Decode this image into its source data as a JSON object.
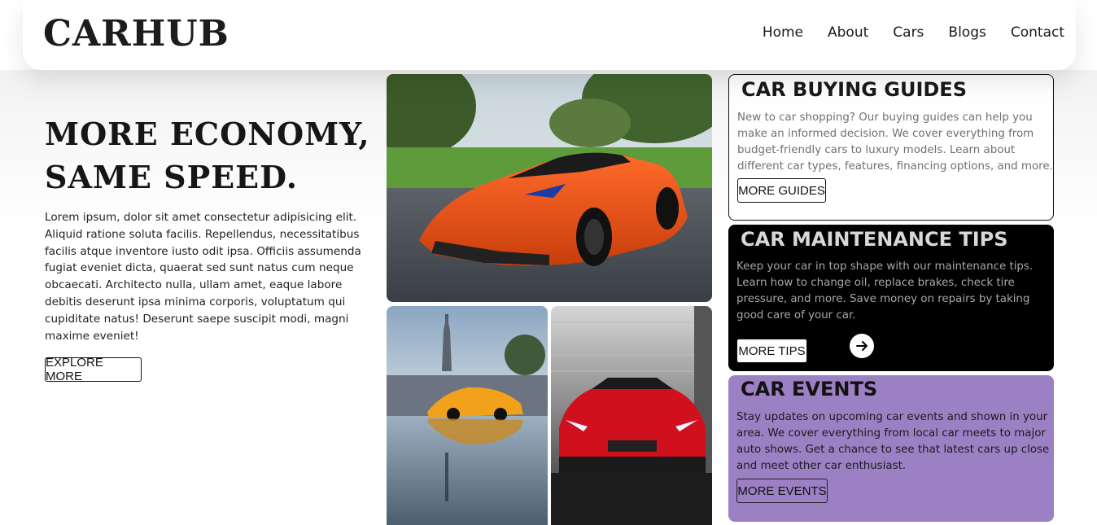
{
  "header": {
    "logo": "CARHUB",
    "nav": [
      "Home",
      "About",
      "Cars",
      "Blogs",
      "Contact"
    ]
  },
  "hero": {
    "title": "MORE ECONOMY, SAME SPEED.",
    "body": "Lorem ipsum, dolor sit amet consectetur adipisicing elit. Aliquid ratione soluta facilis. Repellendus, necessitatibus facilis atque inventore iusto odit ipsa. Officiis assumenda fugiat eveniet dicta, quaerat sed sunt natus cum neque obcaecati. Architecto nulla, ullam amet, eaque labore debitis deserunt ipsa minima corporis, voluptatum qui cupiditate natus! Deserunt saepe suscipit modi, magni maxime eveniet!",
    "button": "EXPLORE MORE"
  },
  "cards": [
    {
      "title": "CAR BUYING GUIDES",
      "body": "New to car shopping? Our buying guides can help you make an informed decision. We cover everything from budget-friendly cars to luxury models. Learn about different car types, features, financing options, and more.",
      "button": "MORE GUIDES"
    },
    {
      "title": "CAR MAINTENANCE TIPS",
      "body": "Keep your car in top shape with our maintenance tips. Learn how to change oil, replace brakes, check tire pressure, and more. Save money on repairs by taking good care of your car.",
      "button": "MORE TIPS",
      "icon": "arrow-right-icon"
    },
    {
      "title": "CAR EVENTS",
      "body": "Stay updates on upcoming car events and shown in your area. We cover everything from local car meets to major auto shows. Get a chance to see that latest cars up close and meet other car enthusiast.",
      "button": "MORE EVENTS"
    }
  ],
  "colors": {
    "maintenance_card_bg": "#000000",
    "events_card_bg": "#9b80c3",
    "text_dark": "#111111"
  }
}
